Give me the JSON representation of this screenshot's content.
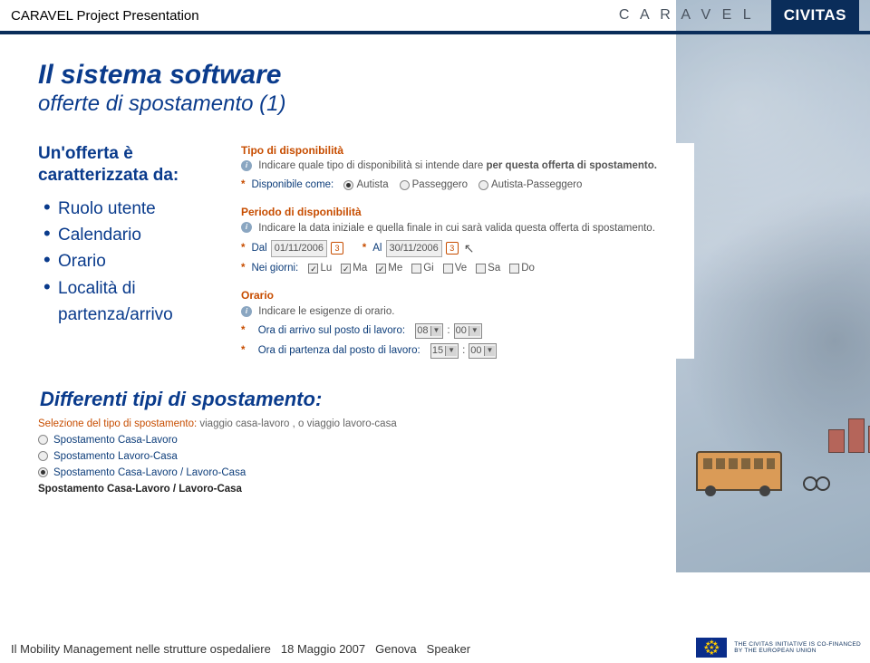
{
  "header": {
    "title": "CARAVEL Project Presentation",
    "logo1": "C A R A V E L",
    "logo2": "CIVITAS"
  },
  "slide": {
    "title": "Il sistema software",
    "subtitle": "offerte di spostamento (1)"
  },
  "offer": {
    "lead": "Un'offerta è caratterizzata da:",
    "items": [
      "Ruolo utente",
      "Calendario",
      "Orario",
      "Località di partenza/arrivo"
    ]
  },
  "form": {
    "tipo_title": "Tipo di disponibilità",
    "tipo_hint": "Indicare quale tipo di disponibilità si intende dare ",
    "tipo_hint_bold": "per questa offerta di spostamento.",
    "disp_label": "Disponibile come:",
    "disp_opts": [
      "Autista",
      "Passeggero",
      "Autista-Passeggero"
    ],
    "periodo_title": "Periodo di disponibilità",
    "periodo_hint": "Indicare la data iniziale e quella finale in cui sarà valida questa offerta di spostamento.",
    "dal_label": "Dal",
    "dal_value": "01/11/2006",
    "al_label": "Al",
    "al_value": "30/11/2006",
    "giorni_label": "Nei giorni:",
    "days": [
      "Lu",
      "Ma",
      "Me",
      "Gi",
      "Ve",
      "Sa",
      "Do"
    ],
    "days_checked": [
      true,
      true,
      true,
      false,
      false,
      false,
      false
    ],
    "orario_title": "Orario",
    "orario_hint": "Indicare le esigenze di orario.",
    "arrivo_label": "Ora di arrivo sul posto di lavoro:",
    "arrivo_h": "08",
    "arrivo_m": "00",
    "partenza_label": "Ora di partenza dal posto di lavoro:",
    "partenza_h": "15",
    "partenza_m": "00"
  },
  "lower": {
    "title": "Differenti tipi di spostamento:",
    "sel_label": "Selezione del tipo di spostamento:",
    "sel_hint": "viaggio casa-lavoro , o viaggio lavoro-casa",
    "opts": [
      "Spostamento Casa-Lavoro",
      "Spostamento Lavoro-Casa",
      "Spostamento Casa-Lavoro / Lavoro-Casa"
    ],
    "final": "Spostamento Casa-Lavoro / Lavoro-Casa"
  },
  "footer": {
    "t1": "Il Mobility Management nelle strutture ospedaliere",
    "t2": "18 Maggio 2007",
    "t3": "Genova",
    "t4": "Speaker",
    "eu1": "THE CIVITAS INITIATIVE IS CO-FINANCED",
    "eu2": "BY THE EUROPEAN UNION"
  }
}
